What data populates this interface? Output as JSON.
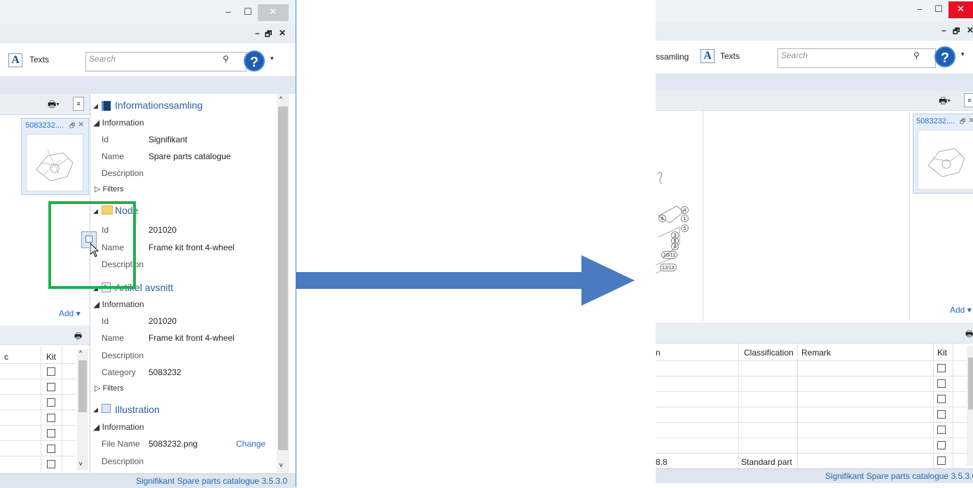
{
  "left_window": {
    "win_controls": {
      "min": "–",
      "max": "☐",
      "close": "✕"
    },
    "mdi_controls": {
      "min": "–",
      "restore": "🗗",
      "close": "✕"
    },
    "ribbon": {
      "texts_label": "Texts",
      "search_placeholder": "Search",
      "help": "?"
    },
    "tab": {
      "title": "5083232...."
    },
    "add_label": "Add",
    "table": {
      "header_kit": "Kit",
      "header_partial": "c"
    },
    "properties": {
      "sec1_title": "Informationssamling",
      "sec1_group": "Information",
      "sec1_rows": [
        {
          "label": "Id",
          "value": "Signifikant"
        },
        {
          "label": "Name",
          "value": "Spare parts catalogue"
        },
        {
          "label": "Description",
          "value": ""
        }
      ],
      "sec1_filters": "Filters",
      "sec2_title_a": "No",
      "sec2_title_b": "de",
      "sec2_rows": [
        {
          "label": "Id",
          "value": "201020"
        },
        {
          "label": "Name",
          "value": "Frame kit front 4-wheel"
        },
        {
          "label": "Description",
          "value": ""
        }
      ],
      "sec3_title": "Artikel avsnitt",
      "sec3_group": "Information",
      "sec3_rows": [
        {
          "label": "Id",
          "value": "201020"
        },
        {
          "label": "Name",
          "value": "Frame kit front 4-wheel"
        },
        {
          "label": "Description",
          "value": ""
        },
        {
          "label": "Category",
          "value": "5083232"
        }
      ],
      "sec3_filters": "Filters",
      "sec4_title": "Illustration",
      "sec4_group": "Information",
      "sec4_rows": [
        {
          "label": "File Name",
          "value": "5083232.png"
        },
        {
          "label": "Description",
          "value": ""
        }
      ],
      "change_label": "Change"
    },
    "status": "Signifikant Spare parts catalogue  3.5.3.0"
  },
  "right_window": {
    "win_controls": {
      "min": "–",
      "max": "☐",
      "close": "✕"
    },
    "mdi_controls": {
      "min": "–",
      "restore": "🗗",
      "close": "✕"
    },
    "ribbon": {
      "partial_label": "ssamling",
      "texts_label": "Texts",
      "search_placeholder": "Search",
      "help": "?"
    },
    "tab": {
      "title": "5083232...."
    },
    "add_label": "Add",
    "diagram_labels": [
      "4",
      "1",
      "6",
      "5",
      "3",
      "8",
      "4",
      "10",
      "11",
      "12",
      "13"
    ],
    "table": {
      "headers": {
        "col1": "n",
        "classification": "Classification",
        "remark": "Remark",
        "kit": "Kit"
      },
      "last_row": {
        "col1": "8.8",
        "classification": "Standard part"
      }
    },
    "status": "Signifikant Spare parts catalogue  3.5.3.0"
  },
  "colors": {
    "arrow": "#4a7abf",
    "highlight": "#1db14b",
    "accent": "#2a6ec4"
  }
}
